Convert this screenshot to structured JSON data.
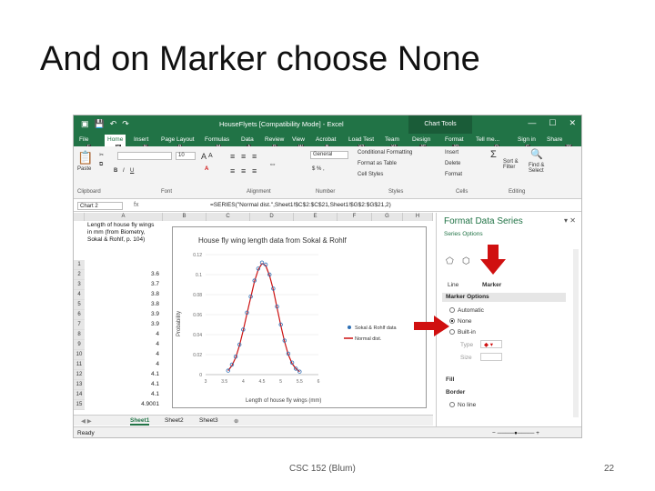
{
  "slide": {
    "title": "And on Marker choose None",
    "footer": "CSC 152 (Blum)",
    "page": "22"
  },
  "window": {
    "title": "HouseFlyets [Compatibility Mode] - Excel",
    "chart_tools": "Chart Tools"
  },
  "tabs": [
    "File",
    "Home",
    "Insert",
    "Page Layout",
    "Formulas",
    "Data",
    "Review",
    "View",
    "Acrobat",
    "Load Test",
    "Team",
    "Design",
    "Format",
    "Tell me...",
    "Sign in",
    "Share"
  ],
  "keytips": [
    "F",
    "H",
    "N",
    "P",
    "M",
    "A",
    "R",
    "W",
    "B",
    "Y2",
    "Y1",
    "JC",
    "JO",
    "Q",
    "G",
    "ZS"
  ],
  "ribbon": {
    "paste": "Paste",
    "font_size": "10",
    "number_format": "General",
    "conditional": "Conditional Formatting",
    "format_table": "Format as Table",
    "cell_styles": "Cell Styles",
    "insert": "Insert",
    "delete": "Delete",
    "format": "Format",
    "sort": "Sort & Filter",
    "find": "Find & Select",
    "groups": [
      "Clipboard",
      "Font",
      "Alignment",
      "Number",
      "Styles",
      "Cells",
      "Editing"
    ]
  },
  "formula_bar": {
    "name_box": "Chart 2",
    "fx": "fx",
    "formula": "=SERIES(\"Normal dist.\",Sheet1!$C$2:$C$21,Sheet1!$G$2:$G$21,2)"
  },
  "grid": {
    "columns": [
      "A",
      "B",
      "C",
      "D",
      "E",
      "F",
      "G",
      "H"
    ],
    "note": "Length of house fly wings in mm (from Biometry, Sokal & Rohlf, p. 104)",
    "rows": [
      "1",
      "2",
      "3",
      "4",
      "5",
      "6",
      "7",
      "8",
      "9",
      "10",
      "11",
      "12",
      "13",
      "14",
      "15"
    ],
    "colA": [
      "",
      "3.6",
      "3.7",
      "3.8",
      "3.8",
      "3.9",
      "3.9",
      "4",
      "4",
      "4",
      "4",
      "4.1",
      "4.1",
      "4.1",
      "4.9001"
    ]
  },
  "chart": {
    "title": "House fly wing length data from Sokal & Rohlf",
    "ylabel": "Probability",
    "xlabel": "Length of house fly wings (mm)",
    "legend": [
      "Sokal & Rohlf data",
      "Normal dist."
    ]
  },
  "chart_data": {
    "type": "scatter",
    "title": "House fly wing length data from Sokal & Rohlf",
    "xlabel": "Length of house fly wings (mm)",
    "ylabel": "Probability",
    "xlim": [
      3,
      6
    ],
    "ylim": [
      0,
      0.12
    ],
    "x_ticks": [
      "3",
      "3.5",
      "4",
      "4.5",
      "5",
      "5.5",
      "6"
    ],
    "y_ticks": [
      "0",
      "0.02",
      "0.04",
      "0.06",
      "0.08",
      "0.1",
      "0.12"
    ],
    "series": [
      {
        "name": "Sokal & Rohlf data",
        "x": [
          3.6,
          3.7,
          3.8,
          3.9,
          4.0,
          4.1,
          4.2,
          4.3,
          4.4,
          4.5,
          4.6,
          4.7,
          4.8,
          4.9,
          5.0,
          5.1,
          5.2,
          5.3,
          5.4,
          5.5
        ],
        "y": [
          0.004,
          0.01,
          0.018,
          0.03,
          0.045,
          0.062,
          0.078,
          0.094,
          0.106,
          0.112,
          0.11,
          0.1,
          0.086,
          0.068,
          0.05,
          0.034,
          0.021,
          0.012,
          0.006,
          0.003
        ]
      },
      {
        "name": "Normal dist.",
        "x": [
          3.6,
          3.7,
          3.8,
          3.9,
          4.0,
          4.1,
          4.2,
          4.3,
          4.4,
          4.5,
          4.6,
          4.7,
          4.8,
          4.9,
          5.0,
          5.1,
          5.2,
          5.3,
          5.4,
          5.5
        ],
        "y": [
          0.004,
          0.009,
          0.017,
          0.029,
          0.044,
          0.061,
          0.077,
          0.093,
          0.105,
          0.111,
          0.109,
          0.099,
          0.085,
          0.067,
          0.049,
          0.033,
          0.02,
          0.011,
          0.006,
          0.003
        ]
      }
    ]
  },
  "sheets": [
    "Sheet1",
    "Sheet2",
    "Sheet3"
  ],
  "status": {
    "ready": "Ready"
  },
  "pane": {
    "title": "Format Data Series",
    "sub": "Series Options",
    "tab_line": "Line",
    "tab_marker": "Marker",
    "marker_options": "Marker Options",
    "automatic": "Automatic",
    "none": "None",
    "builtin": "Built-in",
    "type": "Type",
    "size": "Size",
    "fill": "Fill",
    "border": "Border",
    "no_line": "No line"
  },
  "colors": {
    "excel_green": "#217346",
    "arrow_red": "#d01010",
    "series_line": "#cc1111",
    "series_marker": "#2e6fb5"
  }
}
